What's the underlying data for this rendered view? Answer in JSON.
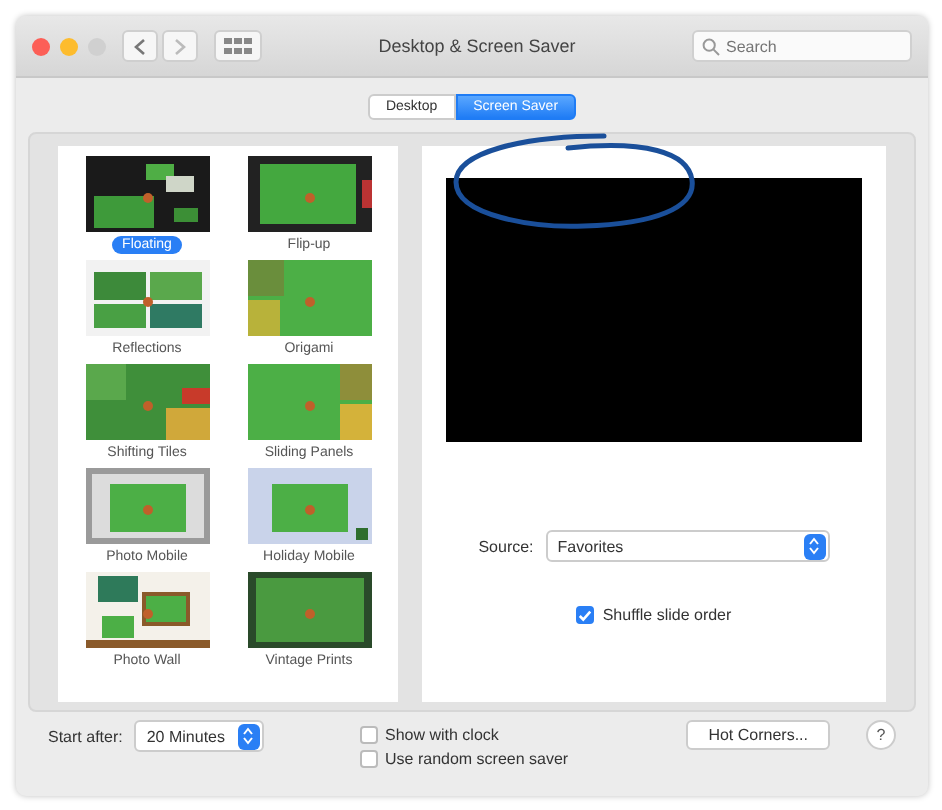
{
  "window": {
    "title": "Desktop & Screen Saver"
  },
  "search": {
    "placeholder": "Search"
  },
  "tabs": [
    {
      "label": "Desktop",
      "selected": false
    },
    {
      "label": "Screen Saver",
      "selected": true
    }
  ],
  "screen_savers": [
    {
      "label": "Floating",
      "selected": true
    },
    {
      "label": "Flip-up",
      "selected": false
    },
    {
      "label": "Reflections",
      "selected": false
    },
    {
      "label": "Origami",
      "selected": false
    },
    {
      "label": "Shifting Tiles",
      "selected": false
    },
    {
      "label": "Sliding Panels",
      "selected": false
    },
    {
      "label": "Photo Mobile",
      "selected": false
    },
    {
      "label": "Holiday Mobile",
      "selected": false
    },
    {
      "label": "Photo Wall",
      "selected": false
    },
    {
      "label": "Vintage Prints",
      "selected": false
    }
  ],
  "source": {
    "label": "Source:",
    "value": "Favorites"
  },
  "shuffle": {
    "label": "Shuffle slide order",
    "checked": true
  },
  "start_after": {
    "label": "Start after:",
    "value": "20 Minutes"
  },
  "options": [
    {
      "label": "Show with clock",
      "checked": false
    },
    {
      "label": "Use random screen saver",
      "checked": false
    }
  ],
  "hot_corners": {
    "label": "Hot Corners..."
  },
  "help": {
    "label": "?"
  }
}
